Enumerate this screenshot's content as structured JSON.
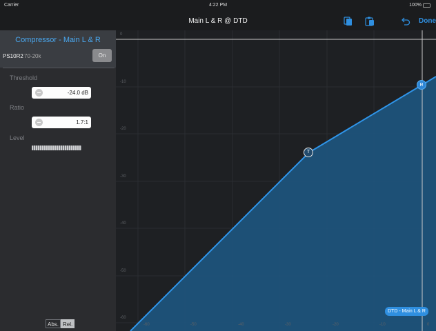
{
  "status_bar": {
    "carrier": "Carrier",
    "time": "4:22 PM",
    "battery": "100%"
  },
  "nav": {
    "title": "Main L & R @ DTD",
    "done_label": "Done"
  },
  "panel": {
    "title": "Compressor - Main L & R",
    "preset_name": "PS10R2",
    "preset_range": "70-20k",
    "on_label": "On",
    "threshold_label": "Threshold",
    "threshold_value": "-24.0 dB",
    "ratio_label": "Ratio",
    "ratio_value": "1.7:1",
    "level_label": "Level",
    "abs_label": "Abs.",
    "rel_label": "Rel."
  },
  "graph": {
    "y_ticks": [
      "0",
      "-10",
      "-20",
      "-30",
      "-40",
      "-50",
      "-60"
    ],
    "x_ticks": [
      "-60",
      "-50",
      "-40",
      "-30",
      "-20",
      "-10",
      "0"
    ],
    "threshold_marker": "T",
    "ratio_marker": "R",
    "output_tag": "DTD - Main L & R"
  },
  "colors": {
    "accent": "#2f8fe0",
    "fill": "#1d5580",
    "line": "#2f95ea",
    "panel": "#2b2c2f",
    "header": "#3a3d42"
  }
}
